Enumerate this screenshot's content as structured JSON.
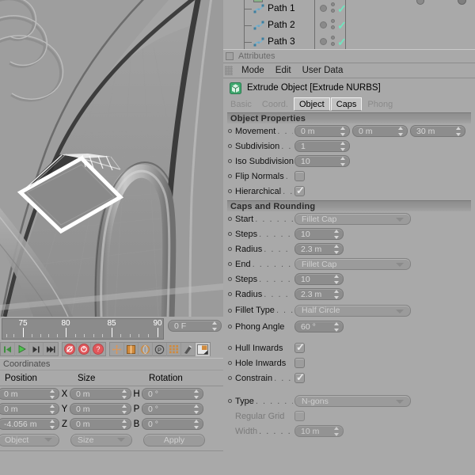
{
  "object_manager": {
    "rows": [
      {
        "label": "Path 1",
        "icon": "spline-icon",
        "visible": true
      },
      {
        "label": "Path 2",
        "icon": "spline-icon",
        "visible": true
      },
      {
        "label": "Path 3",
        "icon": "spline-icon",
        "visible": true
      }
    ],
    "check_color": "#6de8c0"
  },
  "attributes": {
    "panel_title": "Attributes",
    "menu": [
      "Mode",
      "Edit",
      "User Data"
    ],
    "object_name": "Extrude Object [Extrude NURBS]",
    "object_icon": "extrude-nurbs-icon",
    "tabs": [
      {
        "label": "Basic",
        "active": false
      },
      {
        "label": "Coord.",
        "active": false
      },
      {
        "label": "Object",
        "active": true
      },
      {
        "label": "Caps",
        "active": true
      },
      {
        "label": "Phong",
        "active": false
      }
    ],
    "sections": [
      {
        "title": "Object Properties",
        "rows": [
          {
            "kind": "number3",
            "label": "Movement",
            "dots": ". . .",
            "values": [
              "0 m",
              "0 m",
              "30 m"
            ]
          },
          {
            "kind": "number",
            "label": "Subdivision",
            "dots": ". .",
            "value": "1"
          },
          {
            "kind": "number",
            "label": "Iso Subdivision",
            "dots": "",
            "value": "10"
          },
          {
            "kind": "check",
            "label": "Flip Normals",
            "dots": ". .",
            "checked": false
          },
          {
            "kind": "check",
            "label": "Hierarchical",
            "dots": ". .",
            "checked": true
          }
        ]
      },
      {
        "title": "Caps and Rounding",
        "rows": [
          {
            "kind": "select",
            "label": "Start",
            "dots": ". . . . . . .",
            "value": "Fillet Cap"
          },
          {
            "kind": "number",
            "label": "Steps",
            "dots": ". . . . . . .",
            "value": "10"
          },
          {
            "kind": "number",
            "label": "Radius",
            "dots": ". . . . . .",
            "value": "2.3 m"
          },
          {
            "kind": "select",
            "label": "End",
            "dots": ". . . . . . .",
            "value": "Fillet Cap"
          },
          {
            "kind": "number",
            "label": "Steps",
            "dots": ". . . . . . .",
            "value": "10"
          },
          {
            "kind": "number",
            "label": "Radius",
            "dots": ". . . . . .",
            "value": "2.3 m"
          },
          {
            "kind": "select",
            "label": "Fillet Type",
            "dots": ". . .",
            "value": "Half Circle"
          },
          {
            "kind": "number",
            "label": "Phong Angle",
            "dots": "",
            "value": "60 °"
          },
          {
            "kind": "gap"
          },
          {
            "kind": "check",
            "label": "Hull Inwards",
            "dots": "",
            "checked": true
          },
          {
            "kind": "check",
            "label": "Hole Inwards",
            "dots": "",
            "checked": false
          },
          {
            "kind": "check",
            "label": "Constrain",
            "dots": ". . .",
            "checked": true
          },
          {
            "kind": "gap"
          },
          {
            "kind": "select",
            "label": "Type",
            "dots": ". . . . . . . .",
            "value": "N-gons"
          },
          {
            "kind": "check",
            "label": "Regular Grid",
            "dots": "",
            "checked": false,
            "dim": true
          },
          {
            "kind": "number",
            "label": "Width",
            "dots": ". . . . . . .",
            "value": "10 m",
            "dim": true
          }
        ]
      }
    ]
  },
  "timeline": {
    "tick_labels": [
      "75",
      "80",
      "85",
      "90"
    ],
    "range_start": 73,
    "range_end": 91,
    "frame_field": "0 F",
    "transport_buttons": [
      "go-to-start-icon",
      "play-icon",
      "step-forward-icon",
      "go-to-end-icon"
    ],
    "record_buttons": [
      "record-icon",
      "autokey-icon",
      "keyframe-selection-icon"
    ],
    "tool_buttons": [
      "move-icon",
      "scale-icon",
      "rotate-icon",
      "parametric-icon",
      "points-icon",
      "magnet-icon",
      "render-region-icon"
    ]
  },
  "coordinates": {
    "title": "Coordinates",
    "headers": [
      "Position",
      "Size",
      "Rotation"
    ],
    "rows": [
      {
        "axis_pos": "X",
        "position": "0 m",
        "size": "0 m",
        "axis_rot": "H",
        "rotation": "0 °"
      },
      {
        "axis_pos": "Y",
        "position": "0 m",
        "size": "0 m",
        "axis_rot": "P",
        "rotation": "0 °"
      },
      {
        "axis_pos": "Z",
        "position": "-4.056 m",
        "size": "0 m",
        "axis_rot": "B",
        "rotation": "0 °"
      }
    ],
    "mode_select": "Object",
    "size_select": "Size",
    "apply_label": "Apply"
  },
  "theme": {
    "bg": "#a9a9a9",
    "panel_bg": "#a9a9a9",
    "field_bg": "#8d8d8d",
    "field_text": "#d8d8d8",
    "section_header": "#8d8d8d",
    "accent_check": "#6de8c0",
    "record_red": "#e2575b",
    "tool_orange": "#d08a3c",
    "play_green": "#4fa04f"
  }
}
